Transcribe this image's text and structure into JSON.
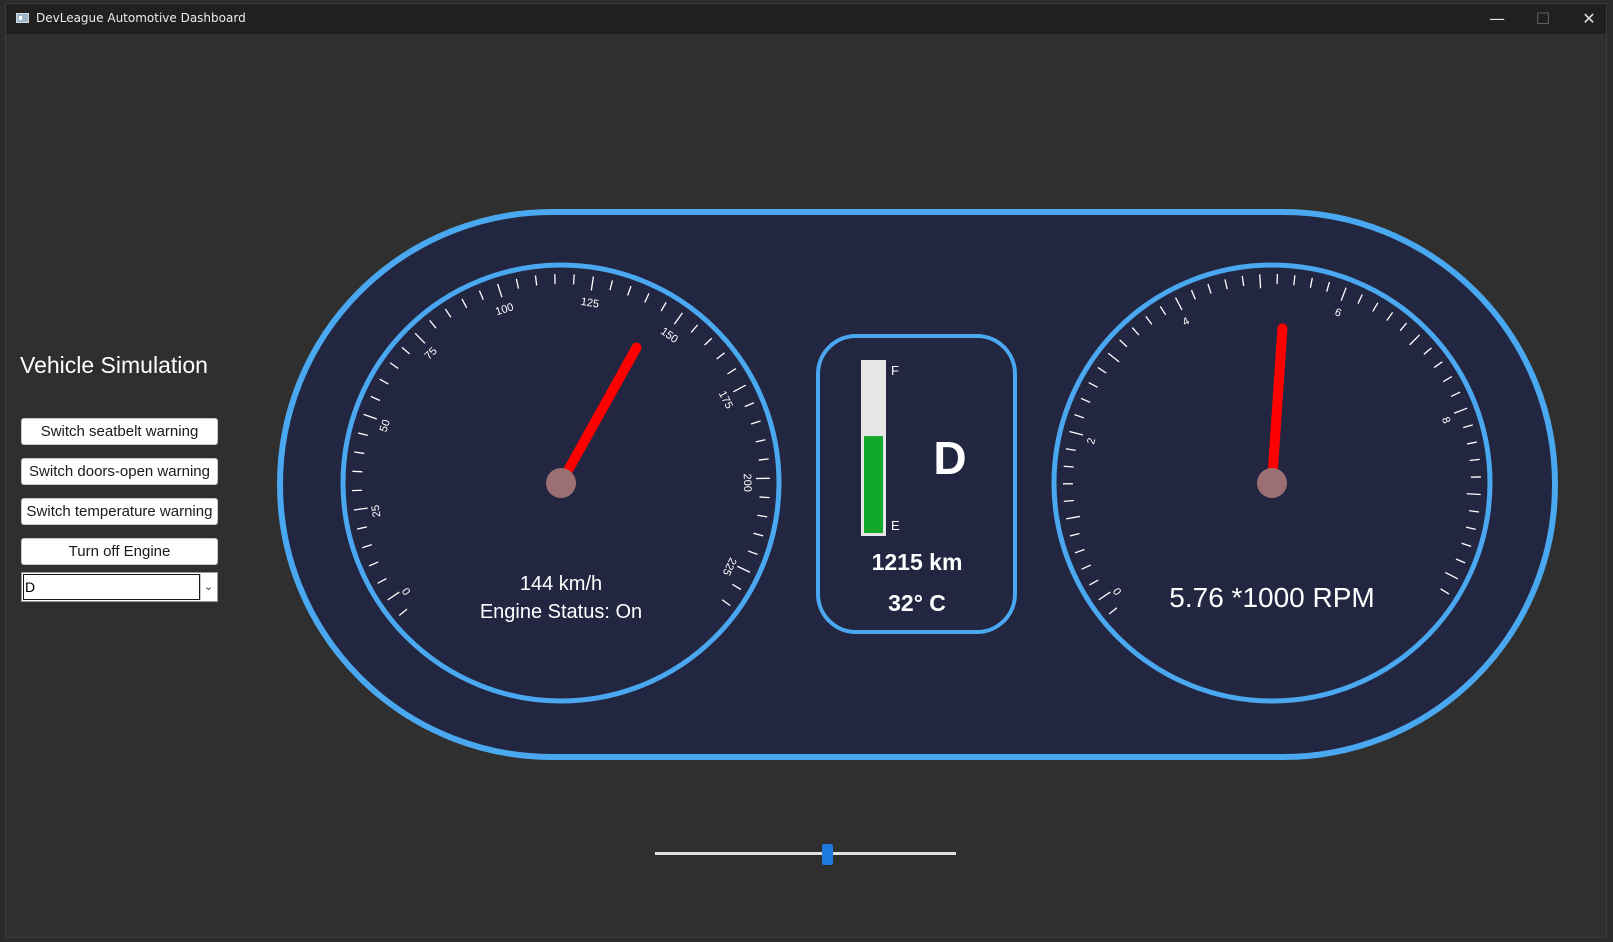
{
  "window": {
    "title": "DevLeague Automotive Dashboard",
    "controls": {
      "minimize": "—",
      "maximize": "☐",
      "close": "✕"
    }
  },
  "simulation": {
    "title": "Vehicle Simulation",
    "buttons": [
      "Switch seatbelt warning",
      "Switch doors-open warning",
      "Switch temperature warning",
      "Turn off Engine"
    ],
    "gear_select": {
      "value": "D",
      "arrow_icon": "chevron-down-icon"
    }
  },
  "speedometer": {
    "tick_labels": [
      "0",
      "25",
      "50",
      "75",
      "100",
      "125",
      "150",
      "175",
      "200",
      "225"
    ],
    "speed_text": "144 km/h",
    "engine_status_text": "Engine Status: On",
    "needle_value_kmh": 144
  },
  "center_panel": {
    "fuel_full_label": "F",
    "fuel_empty_label": "E",
    "fuel_level_fraction": 0.57,
    "gear": "D",
    "odometer": "1215 km",
    "temperature": "32° C"
  },
  "tachometer": {
    "tick_labels": [
      "0",
      "2",
      "4",
      "6",
      "8"
    ],
    "rpm_text": "5.76 *1000 RPM",
    "needle_value_krpm": 5.76
  },
  "slider": {
    "value_fraction": 0.57
  },
  "colors": {
    "panel_bg": "#232641",
    "accent_blue": "#4aa8f0",
    "needle_red": "#ff0000",
    "hub": "#9c7073",
    "fuel_green": "#12a82a",
    "fuel_bg": "#e6e6e6",
    "slider_blue": "#1f7ae0"
  }
}
